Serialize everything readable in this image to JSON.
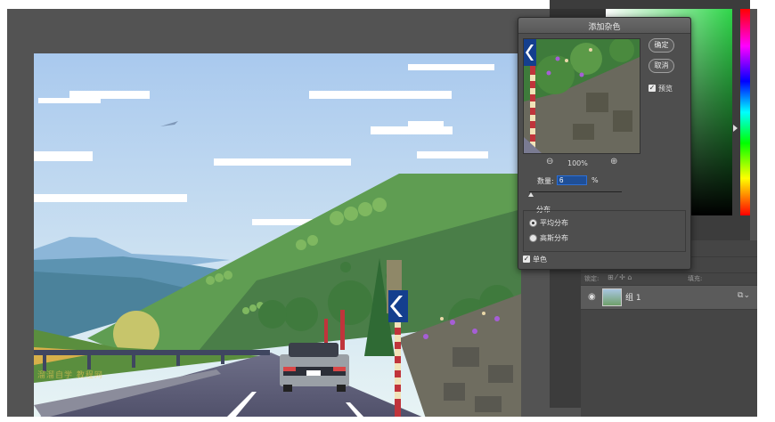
{
  "dialog": {
    "title": "添加杂色",
    "ok_label": "确定",
    "cancel_label": "取消",
    "preview_checkbox": {
      "label": "预览",
      "checked": true
    },
    "zoom_level": "100%",
    "amount_label": "数量:",
    "amount_value": "6",
    "amount_unit": "%",
    "amount_fraction": 0.015,
    "distribution": {
      "group_label": "分布",
      "options": [
        {
          "label": "平均分布",
          "selected": true
        },
        {
          "label": "高斯分布",
          "selected": false
        }
      ]
    },
    "monochrome_checkbox": {
      "label": "单色",
      "checked": true
    }
  },
  "layers": {
    "layer_name": "组 1",
    "locks_label": "锁定:",
    "fill_label": "填充:"
  },
  "icons": [
    "zoom-out-icon",
    "zoom-in-icon",
    "eye-icon",
    "checkbox-check-icon",
    "lock-icon"
  ],
  "colors": {
    "accent": "#2c6fd6",
    "panel_bg": "#535353",
    "dialog_bg": "#4e4e4e"
  },
  "watermark": "溜溜自学 教程网"
}
